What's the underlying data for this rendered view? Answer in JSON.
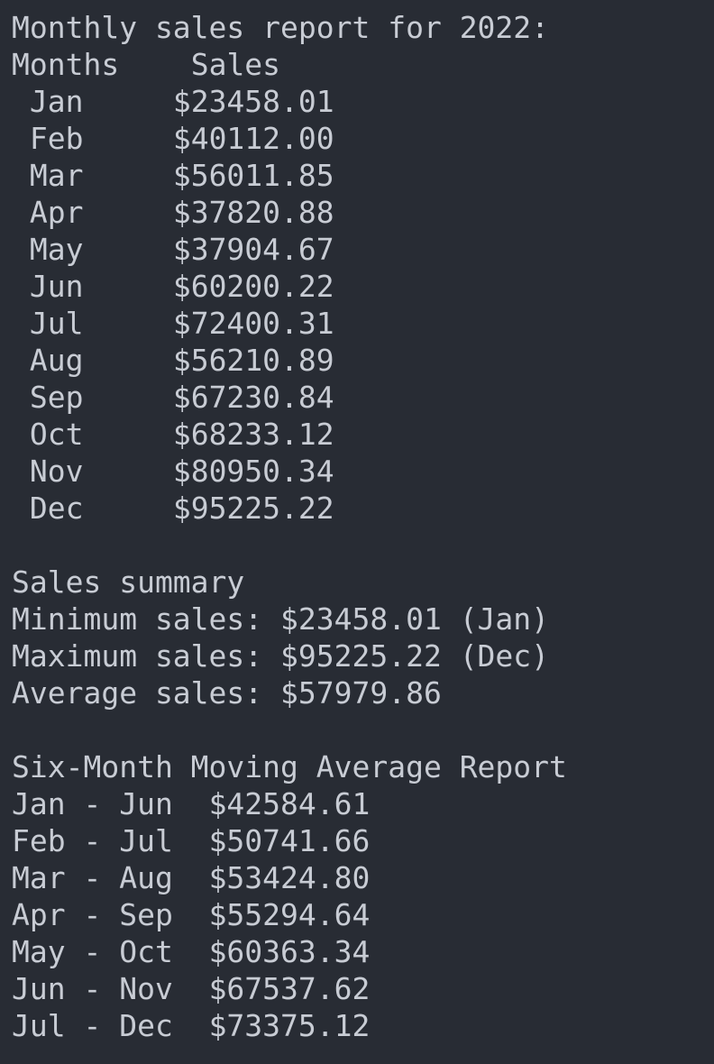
{
  "terminal": {
    "background": "#282c34",
    "foreground": "#c8ccd4",
    "title_line": "Monthly sales report for 2022:",
    "header": {
      "months": "Months",
      "sales": "Sales"
    },
    "monthly": [
      {
        "month": "Jan",
        "sales": "$23458.01"
      },
      {
        "month": "Feb",
        "sales": "$40112.00"
      },
      {
        "month": "Mar",
        "sales": "$56011.85"
      },
      {
        "month": "Apr",
        "sales": "$37820.88"
      },
      {
        "month": "May",
        "sales": "$37904.67"
      },
      {
        "month": "Jun",
        "sales": "$60200.22"
      },
      {
        "month": "Jul",
        "sales": "$72400.31"
      },
      {
        "month": "Aug",
        "sales": "$56210.89"
      },
      {
        "month": "Sep",
        "sales": "$67230.84"
      },
      {
        "month": "Oct",
        "sales": "$68233.12"
      },
      {
        "month": "Nov",
        "sales": "$80950.34"
      },
      {
        "month": "Dec",
        "sales": "$95225.22"
      }
    ],
    "summary": {
      "heading": "Sales summary",
      "minimum": "Minimum sales: $23458.01 (Jan)",
      "maximum": "Maximum sales: $95225.22 (Dec)",
      "average": "Average sales: $57979.86"
    },
    "moving_average": {
      "heading": "Six-Month Moving Average Report",
      "rows": [
        {
          "period": "Jan - Jun",
          "value": "$42584.61"
        },
        {
          "period": "Feb - Jul",
          "value": "$50741.66"
        },
        {
          "period": "Mar - Aug",
          "value": "$53424.80"
        },
        {
          "period": "Apr - Sep",
          "value": "$55294.64"
        },
        {
          "period": "May - Oct",
          "value": "$60363.34"
        },
        {
          "period": "Jun - Nov",
          "value": "$67537.62"
        },
        {
          "period": "Jul - Dec",
          "value": "$73375.12"
        }
      ]
    }
  }
}
